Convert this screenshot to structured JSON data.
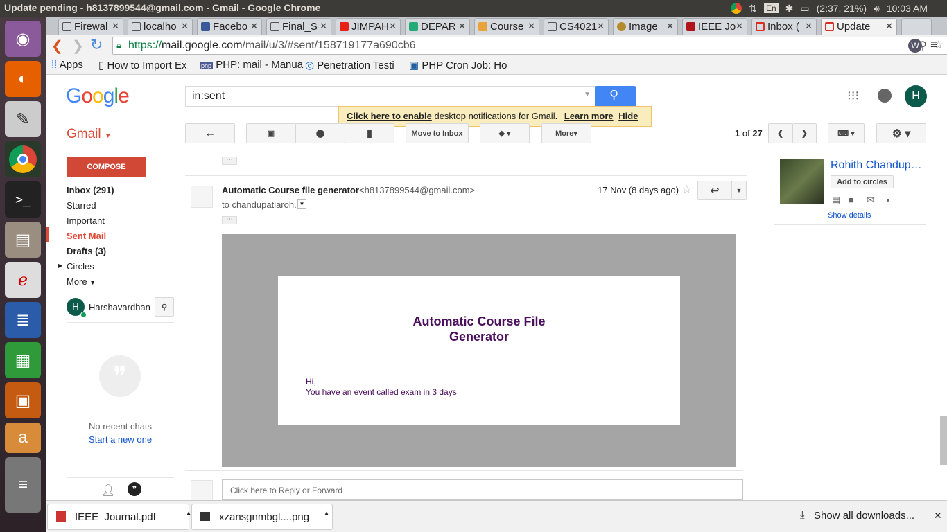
{
  "window_title": "Update pending - h8137899544@gmail.com - Gmail - Google Chrome",
  "tray": {
    "lang": "En",
    "battery": "(2:37, 21%)",
    "clock": "10:03 AM"
  },
  "tabs": [
    "Firewal",
    "localho",
    "Facebo",
    "Final_S",
    "JIMPAH",
    "DEPAR",
    "Course",
    "CS4021",
    "Image",
    "IEEE Jo",
    "Inbox (",
    "Update"
  ],
  "url": {
    "scheme": "https://",
    "host": "mail.google.com",
    "path": "/mail/u/3/#sent/158719177a690cb6"
  },
  "bookmarks": [
    "Apps",
    "How to Import Ex",
    "PHP: mail - Manua",
    "Penetration Testi",
    "PHP Cron Job: Ho"
  ],
  "search": {
    "value": "in:sent"
  },
  "notification": {
    "link": "Click here to enable",
    "text": "desktop notifications for Gmail.",
    "learn": "Learn more",
    "hide": "Hide"
  },
  "brand": "Gmail",
  "toolbar": {
    "move": "Move to Inbox",
    "more": "More",
    "pager_cur": "1",
    "pager_of": "of",
    "pager_total": "27"
  },
  "compose": "COMPOSE",
  "nav": [
    {
      "label": "Inbox (291)",
      "bold": true
    },
    {
      "label": "Starred"
    },
    {
      "label": "Important"
    },
    {
      "label": "Sent Mail",
      "active": true
    },
    {
      "label": "Drafts (3)",
      "bold": true
    },
    {
      "label": "Circles"
    },
    {
      "label": "More"
    }
  ],
  "user": {
    "initial": "H",
    "name": "Harshavardhan"
  },
  "chats": {
    "none": "No recent chats",
    "start": "Start a new one"
  },
  "message": {
    "sender": "Automatic Course file generator",
    "email": "<h8137899544@gmail.com>",
    "to": "to chandupatlaroh.",
    "date": "17 Nov (8 days ago)",
    "ellipsis": "⋯"
  },
  "email_body": {
    "title_line1": "Automatic Course File",
    "title_line2": "Generator",
    "greet": "Hi,",
    "text": "You have an event called exam in 3 days"
  },
  "contact": {
    "name": "Rohith Chandup…",
    "add": "Add to circles",
    "details": "Show details"
  },
  "reply_placeholder": "Click here to Reply or Forward",
  "downloads": {
    "file1": "IEEE_Journal.pdf",
    "file2": "xzansgnmbgl....png",
    "show": "Show all downloads..."
  },
  "colors": {
    "gmail_red": "#dd4b39",
    "compose": "#d14836",
    "link": "#1155cc",
    "email_purple": "#4a0e5c"
  }
}
